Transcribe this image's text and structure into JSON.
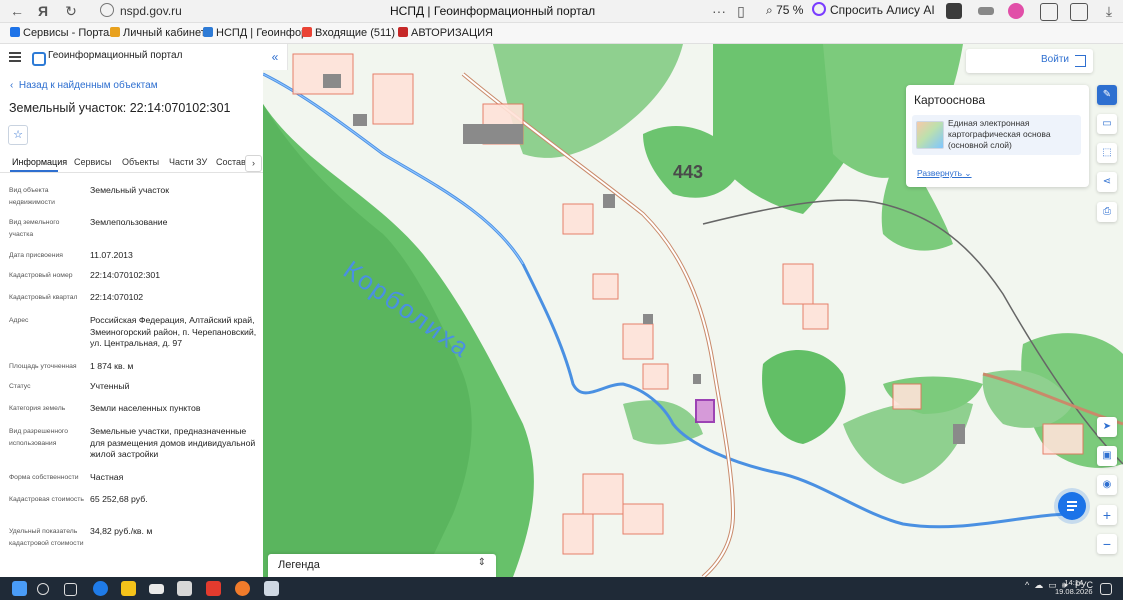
{
  "browser": {
    "url": "nspd.gov.ru",
    "tab_title": "НСПД | Геоинформационный портал",
    "zoom": "75 %",
    "alice_label": "Спросить Алису AI",
    "more": "···"
  },
  "bookmarks": [
    {
      "label": "Сервисы - Портал",
      "color": "#1e73e8"
    },
    {
      "label": "Личный кабинет",
      "color": "#e8a11e"
    },
    {
      "label": "НСПД | Геоинфор",
      "color": "#2e7bd6"
    },
    {
      "label": "Входящие (511)",
      "color": "#ea4335"
    },
    {
      "label": "АВТОРИЗАЦИЯ",
      "color": "#c62828"
    }
  ],
  "portal": {
    "name": "Геоинформационный портал"
  },
  "panel": {
    "back": "Назад к найденным объектам",
    "title": "Земельный участок: 22:14:070102:301",
    "favorite_icon": "☆",
    "tabs": [
      "Информация",
      "Сервисы",
      "Объекты",
      "Части ЗУ",
      "Состав"
    ],
    "tab_next": "›",
    "properties": [
      {
        "label": "Вид объекта недвижимости",
        "value": "Земельный участок"
      },
      {
        "label": "Вид земельного участка",
        "value": "Землепользование"
      },
      {
        "label": "Дата присвоения",
        "value": "11.07.2013"
      },
      {
        "label": "Кадастровый номер",
        "value": "22:14:070102:301"
      },
      {
        "label": "Кадастровый квартал",
        "value": "22:14:070102"
      },
      {
        "label": "Адрес",
        "value": "Российская Федерация, Алтайский край, Змеиногорский район, п. Черепановский, ул. Центральная, д. 97"
      },
      {
        "label": "Площадь уточненная",
        "value": "1 874 кв. м"
      },
      {
        "label": "Статус",
        "value": "Учтенный"
      },
      {
        "label": "Категория земель",
        "value": "Земли населенных пунктов"
      },
      {
        "label": "Вид разрешенного использования",
        "value": "Земельные участки, предназначенные для размещения домов индивидуальной жилой застройки"
      },
      {
        "label": "Форма собственности",
        "value": "Частная"
      },
      {
        "label": "Кадастровая стоимость",
        "value": "65 252,68 руб."
      },
      {
        "label": "Удельный показатель кадастровой стоимости",
        "value": "34,82 руб./кв. м"
      }
    ]
  },
  "map": {
    "collapse_icon": "«",
    "login": "Войти",
    "basemap_title": "Картооснова",
    "basemap_item": "Единая электронная картографическая основа (основной слой)",
    "expand": "Развернуть",
    "river_label": "Корболиха",
    "elevation_label": "443",
    "legend": "Легенда",
    "legend_arrow": "⇕",
    "tools": [
      "pen-icon",
      "ruler-icon",
      "select-area-icon",
      "share-icon",
      "print-icon",
      "locate-icon",
      "layers-icon",
      "camera-icon",
      "zoom-in-icon",
      "zoom-out-icon"
    ],
    "zoom_in": "+",
    "zoom_out": "−"
  },
  "taskbar": {
    "lang": "РУС",
    "time": "14:14",
    "date": "19.08.2026"
  }
}
